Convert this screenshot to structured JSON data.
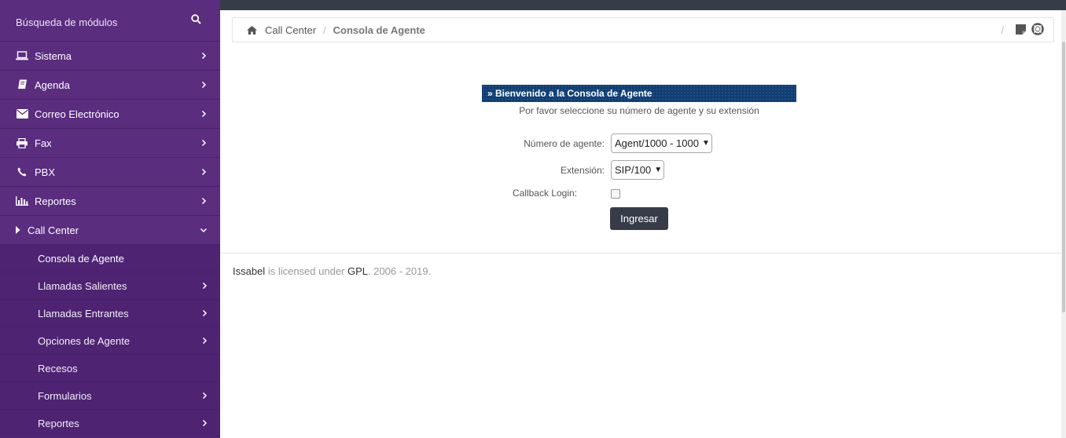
{
  "sidebar": {
    "search_label": "Búsqueda de módulos",
    "items": [
      {
        "label": "Sistema",
        "icon": "laptop-icon"
      },
      {
        "label": "Agenda",
        "icon": "book-icon"
      },
      {
        "label": "Correo Electrónico",
        "icon": "envelope-icon"
      },
      {
        "label": "Fax",
        "icon": "printer-icon"
      },
      {
        "label": "PBX",
        "icon": "phone-icon"
      },
      {
        "label": "Reportes",
        "icon": "bar-chart-icon"
      },
      {
        "label": "Call Center",
        "icon": "caret-right-icon"
      }
    ],
    "subitems": [
      {
        "label": "Consola de Agente"
      },
      {
        "label": "Llamadas Salientes"
      },
      {
        "label": "Llamadas Entrantes"
      },
      {
        "label": "Opciones de Agente"
      },
      {
        "label": "Recesos"
      },
      {
        "label": "Formularios"
      },
      {
        "label": "Reportes"
      }
    ]
  },
  "breadcrumb": {
    "parent": "Call Center",
    "current": "Consola de Agente",
    "right_separator": "/"
  },
  "panel": {
    "title": "» Bienvenido a la Consola de Agente",
    "subtitle": "Por favor seleccione su número de agente y su extensión"
  },
  "form": {
    "agent_label": "Número de agente:",
    "agent_value": "Agent/1000 - 1000",
    "extension_label": "Extensión:",
    "extension_value": "SIP/100",
    "callback_label": "Callback Login:",
    "submit_label": "Ingresar"
  },
  "footer": {
    "brand": "Issabel",
    "middle": " is licensed under ",
    "license": "GPL",
    "years": ". 2006 - 2019."
  },
  "colors": {
    "sidebar_bg": "#5a2d7f",
    "submenu_bg": "#4e2472",
    "topbar_bg": "#373d48",
    "panel_title_bg": "#0f3e74",
    "button_bg": "#373d48"
  }
}
